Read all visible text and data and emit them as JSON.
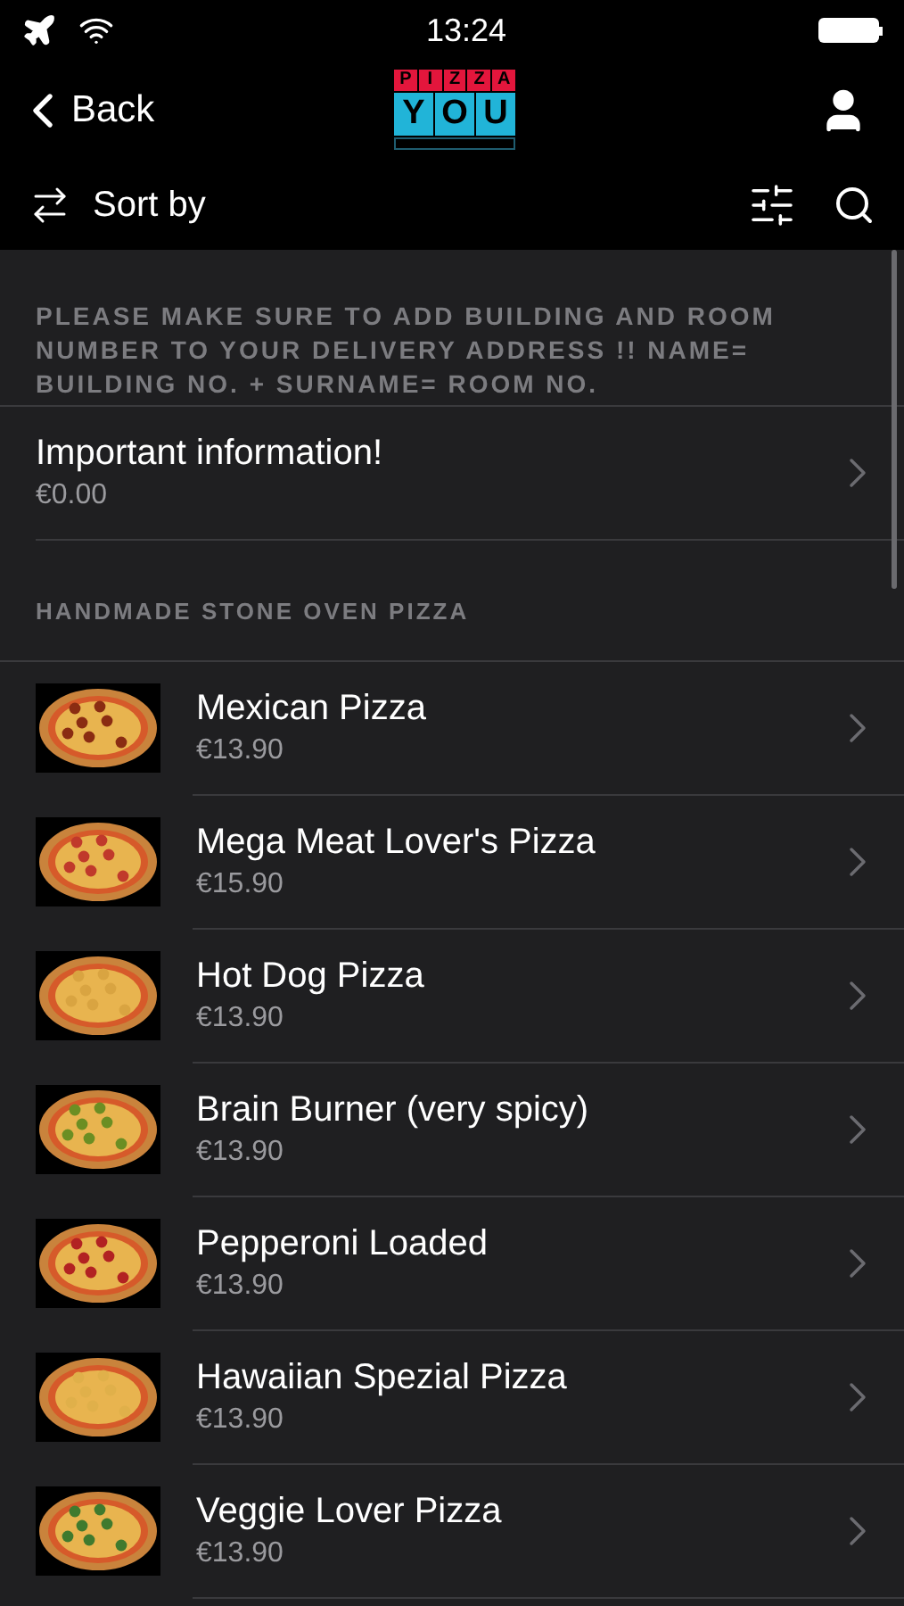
{
  "status_bar": {
    "time": "13:24"
  },
  "nav": {
    "back": "Back",
    "logo": {
      "top": [
        "P",
        "I",
        "Z",
        "Z",
        "A"
      ],
      "bottom": [
        "Y",
        "O",
        "U"
      ]
    }
  },
  "toolbar": {
    "sort": "Sort by"
  },
  "notice": "PLEASE MAKE SURE TO ADD BUILDING AND ROOM NUMBER TO YOUR DELIVERY ADDRESS !! NAME= BUILDING NO. + SURNAME= ROOM NO.",
  "info_item": {
    "title": "Important information!",
    "price": "€0.00"
  },
  "section": {
    "title": "HANDMADE STONE OVEN PIZZA",
    "items": [
      {
        "name": "Mexican Pizza",
        "price": "€13.90",
        "kind": "picture"
      },
      {
        "name": "Mega Meat Lover's Pizza",
        "price": "€15.90",
        "kind": "picture"
      },
      {
        "name": "Hot Dog Pizza",
        "price": "€13.90",
        "kind": "picture"
      },
      {
        "name": "Brain Burner (very spicy)",
        "price": "€13.90",
        "kind": "picture"
      },
      {
        "name": "Pepperoni Loaded",
        "price": "€13.90",
        "kind": "picture"
      },
      {
        "name": "Hawaiian Spezial Pizza",
        "price": "€13.90",
        "kind": "picture"
      },
      {
        "name": "Veggie Lover Pizza",
        "price": "€13.90",
        "kind": "picture"
      }
    ]
  }
}
